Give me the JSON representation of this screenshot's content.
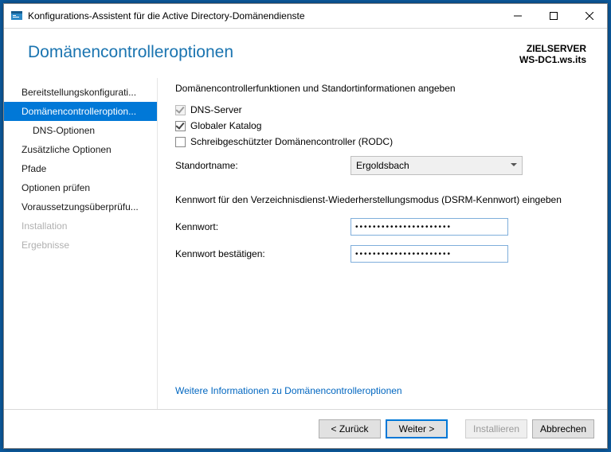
{
  "window": {
    "title": "Konfigurations-Assistent für die Active Directory-Domänendienste"
  },
  "header": {
    "title": "Domänencontrolleroptionen",
    "target_label": "ZIELSERVER",
    "target_server": "WS-DC1.ws.its"
  },
  "nav": [
    {
      "label": "Bereitstellungskonfigurati...",
      "top": true
    },
    {
      "label": "Domänencontrolleroption...",
      "top": true,
      "selected": true
    },
    {
      "label": "DNS-Optionen"
    },
    {
      "label": "Zusätzliche Optionen",
      "top": true
    },
    {
      "label": "Pfade",
      "top": true
    },
    {
      "label": "Optionen prüfen",
      "top": true
    },
    {
      "label": "Voraussetzungsüberprüfu...",
      "top": true
    },
    {
      "label": "Installation",
      "top": true,
      "disabled": true
    },
    {
      "label": "Ergebnisse",
      "top": true,
      "disabled": true
    }
  ],
  "content": {
    "section1_title": "Domänencontrollerfunktionen und Standortinformationen angeben",
    "dns_label": "DNS-Server",
    "gc_label": "Globaler Katalog",
    "rodc_label": "Schreibgeschützter Domänencontroller (RODC)",
    "site_label": "Standortname:",
    "site_value": "Ergoldsbach",
    "section2_title": "Kennwort für den Verzeichnisdienst-Wiederherstellungsmodus (DSRM-Kennwort) eingeben",
    "pw_label": "Kennwort:",
    "pw_confirm_label": "Kennwort bestätigen:",
    "pw_mask": "••••••••••••••••••••••",
    "more_info": "Weitere Informationen zu Domänencontrolleroptionen"
  },
  "footer": {
    "back": "< Zurück",
    "next": "Weiter >",
    "install": "Installieren",
    "cancel": "Abbrechen"
  }
}
